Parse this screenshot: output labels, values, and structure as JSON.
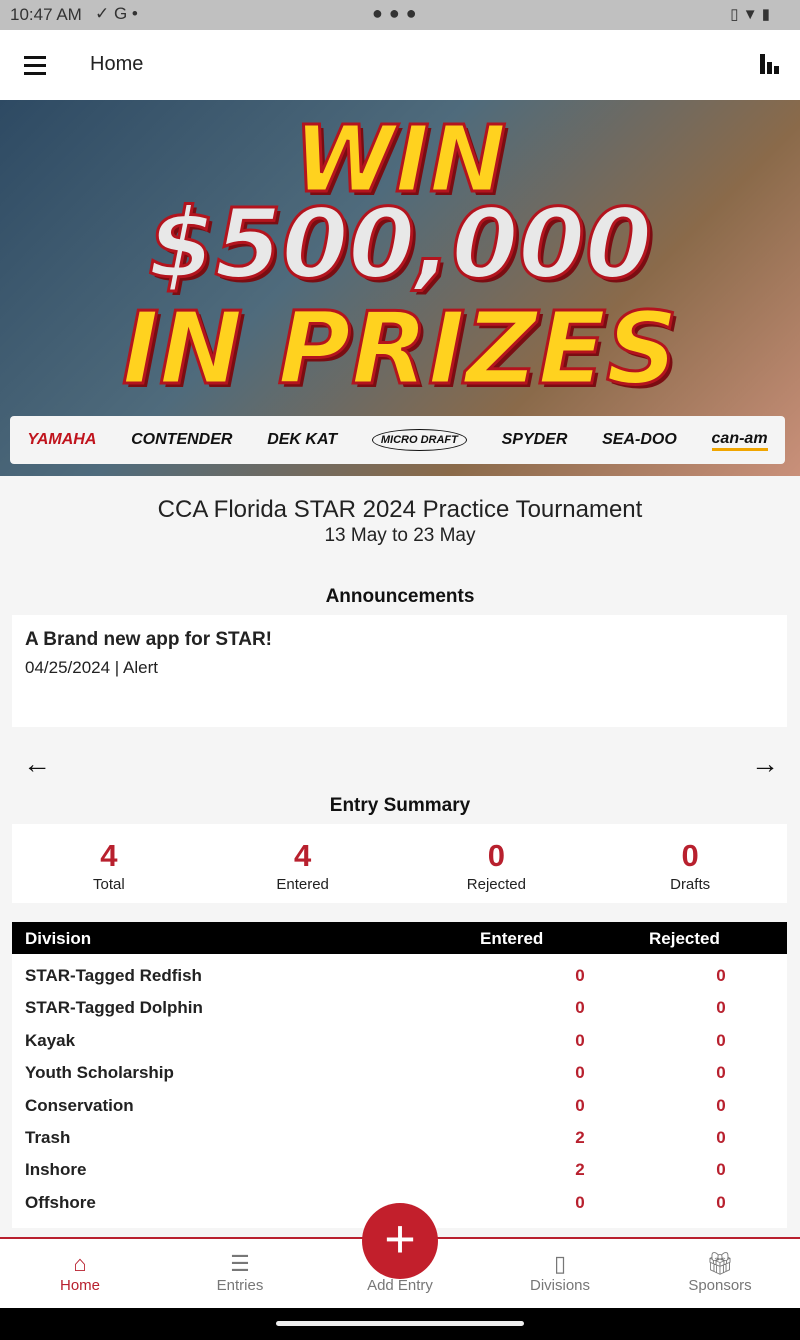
{
  "status_bar": {
    "time": "10:47 AM",
    "icons": [
      "check-circle-icon",
      "google-icon",
      "dot-icon",
      "vibrate-icon",
      "wifi-icon",
      "battery-icon"
    ]
  },
  "app_bar": {
    "title": "Home"
  },
  "banner": {
    "line1": "WIN",
    "line2": "$500,000",
    "line3": "IN PRIZES",
    "sponsors": [
      "YAMAHA",
      "CONTENDER",
      "DEK KAT",
      "MICRO DRAFT",
      "SPYDER",
      "SEA-DOO",
      "can-am"
    ]
  },
  "tournament": {
    "title": "CCA Florida STAR 2024 Practice Tournament",
    "dates": "13 May to 23 May"
  },
  "announcements": {
    "heading": "Announcements",
    "items": [
      {
        "title": "A Brand new app for STAR!",
        "meta": "04/25/2024 | Alert"
      }
    ]
  },
  "entry_summary": {
    "heading": "Entry Summary",
    "stats": [
      {
        "value": "4",
        "label": "Total"
      },
      {
        "value": "4",
        "label": "Entered"
      },
      {
        "value": "0",
        "label": "Rejected"
      },
      {
        "value": "0",
        "label": "Drafts"
      }
    ]
  },
  "divisions_table": {
    "headers": [
      "Division",
      "Entered",
      "Rejected"
    ],
    "rows": [
      {
        "division": "STAR-Tagged Redfish",
        "entered": "0",
        "rejected": "0"
      },
      {
        "division": "STAR-Tagged Dolphin",
        "entered": "0",
        "rejected": "0"
      },
      {
        "division": "Kayak",
        "entered": "0",
        "rejected": "0"
      },
      {
        "division": "Youth Scholarship",
        "entered": "0",
        "rejected": "0"
      },
      {
        "division": "Conservation",
        "entered": "0",
        "rejected": "0"
      },
      {
        "division": "Trash",
        "entered": "2",
        "rejected": "0"
      },
      {
        "division": "Inshore",
        "entered": "2",
        "rejected": "0"
      },
      {
        "division": "Offshore",
        "entered": "0",
        "rejected": "0"
      }
    ]
  },
  "bottom_nav": {
    "items": [
      {
        "label": "Home"
      },
      {
        "label": "Entries"
      },
      {
        "label": "Add Entry"
      },
      {
        "label": "Divisions"
      },
      {
        "label": "Sponsors"
      }
    ]
  },
  "colors": {
    "accent": "#b8202e",
    "fab": "#c21f2c"
  }
}
